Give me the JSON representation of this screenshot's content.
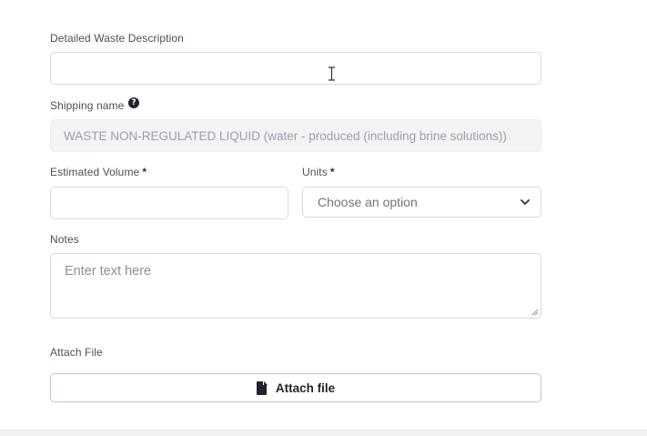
{
  "form": {
    "description": {
      "label": "Detailed Waste Description",
      "value": ""
    },
    "shipping_name": {
      "label": "Shipping name",
      "help_icon": "?",
      "value": "WASTE NON-REGULATED LIQUID (water - produced (including brine solutions))"
    },
    "estimated_volume": {
      "label": "Estimated Volume",
      "required_marker": "*",
      "value": ""
    },
    "units": {
      "label": "Units",
      "required_marker": "*",
      "selected": "Choose an option"
    },
    "notes": {
      "label": "Notes",
      "placeholder": "Enter text here"
    },
    "attach": {
      "label": "Attach File",
      "button_label": "Attach file"
    }
  },
  "icons": {
    "help": "question-circle-icon",
    "chevron": "chevron-down-icon",
    "file": "file-icon",
    "cursor": "text-cursor-icon"
  },
  "colors": {
    "text": "#1f2330",
    "label": "#4b4f5c",
    "border": "#d6d9df",
    "readonly_bg": "#f3f4f6",
    "attach_border": "#b7c6dc"
  }
}
